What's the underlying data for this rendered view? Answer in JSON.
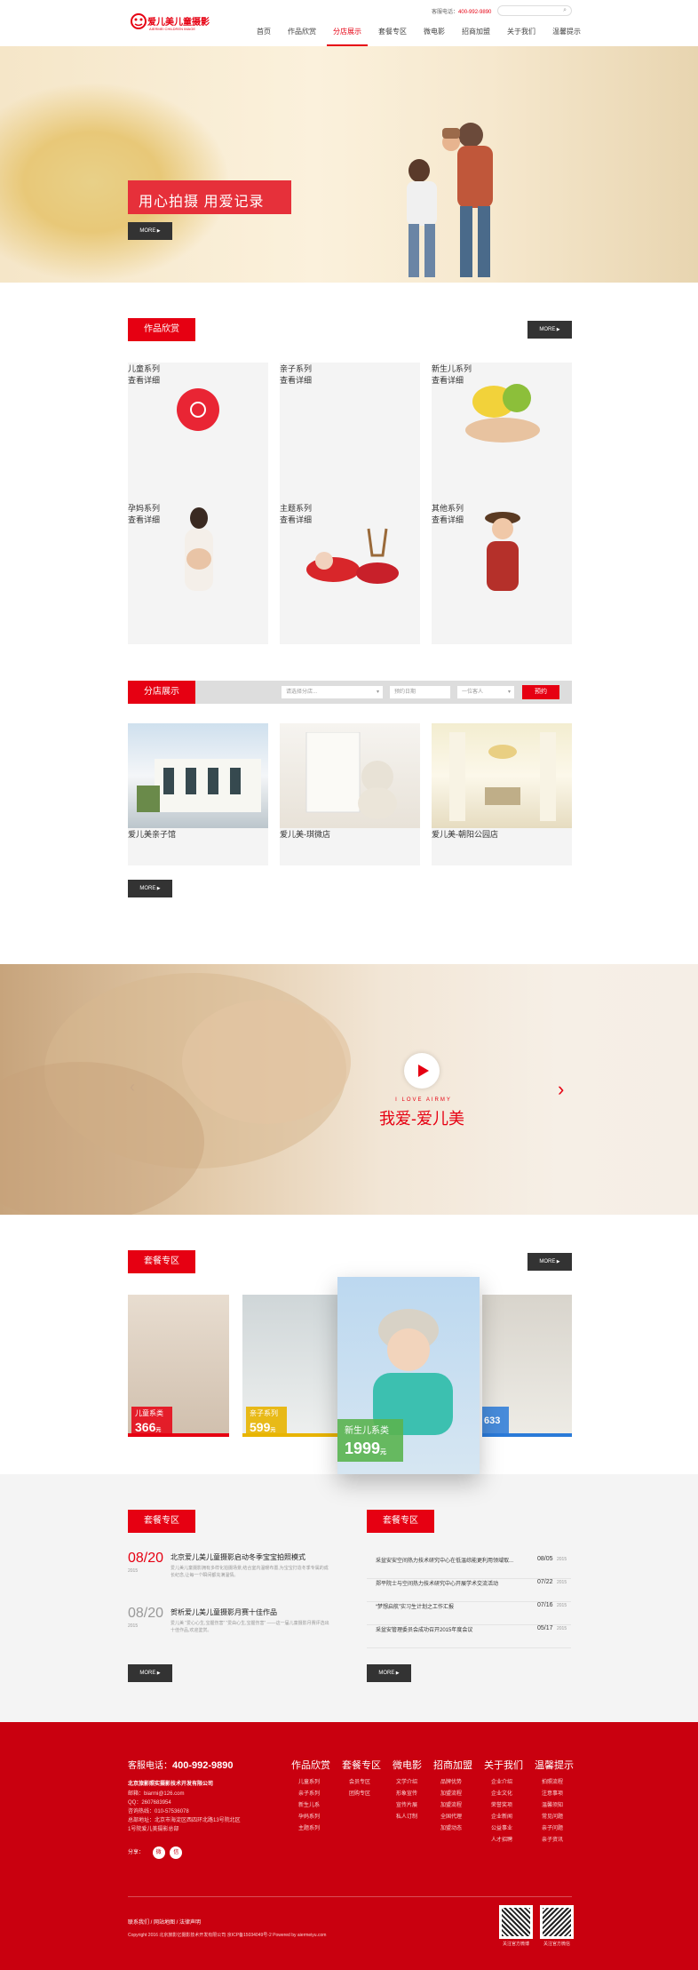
{
  "header": {
    "logo_text": "爱儿美儿童摄影",
    "logo_sub": "AIERMEI CHILDREN IMAGE",
    "hotline_label": "客服电话：",
    "hotline": "400-992-9890",
    "nav": [
      "首页",
      "作品欣赏",
      "分店展示",
      "套餐专区",
      "微电影",
      "招商加盟",
      "关于我们",
      "温馨提示"
    ],
    "active_nav": 2
  },
  "hero": {
    "slogan": "用心拍摄  用爱记录",
    "more": "MORE"
  },
  "works": {
    "title": "作品欣赏",
    "more": "MORE",
    "items": [
      {
        "title": "儿童系列",
        "sub": "查看详细"
      },
      {
        "title": "亲子系列",
        "sub": "查看详细"
      },
      {
        "title": "新生儿系列",
        "sub": "查看详细"
      },
      {
        "title": "孕妈系列",
        "sub": "查看详细"
      },
      {
        "title": "主题系列",
        "sub": "查看详细"
      },
      {
        "title": "其他系列",
        "sub": "查看详细"
      }
    ]
  },
  "stores": {
    "title": "分店展示",
    "select1": "请选择分店...",
    "select2": "预约日期",
    "select3": "一位客人",
    "book": "预约",
    "items": [
      "爱儿美亲子馆",
      "爱儿美-琪微店",
      "爱儿美-朝阳公园店"
    ],
    "more": "MORE"
  },
  "video": {
    "small": "I  LOVE  AIRMY",
    "big": "我爱-爱儿美"
  },
  "packages": {
    "title": "套餐专区",
    "more": "MORE",
    "items": [
      {
        "name": "儿童系类",
        "price": "366",
        "unit": "元"
      },
      {
        "name": "亲子系列",
        "price": "599",
        "unit": "元"
      },
      {
        "name": "新生儿系类",
        "price": "1999",
        "unit": "元"
      },
      {
        "name": "",
        "price": "633",
        "unit": "元"
      }
    ]
  },
  "news_left": {
    "title": "套餐专区",
    "more": "MORE",
    "items": [
      {
        "date": "08/20",
        "year": "2015",
        "headline": "北京爱儿美儿童摄影启动冬季宝宝拍照模式",
        "text": "爱儿美儿童摄影拥有多样化拍摄场景,结合室内温暖布置,为宝宝打造冬季专属的成长纪念,让每一个瞬间都充满温情。"
      },
      {
        "date": "08/20",
        "year": "2015",
        "headline": "贺析爱儿美儿童摄影月赛十佳作品",
        "text": "爱儿美 “爱心心生,宝握伤害” “爱由心生,宝握伤害” ——这一届儿童摄影月赛评选出十佳作品,欢迎鉴赏。"
      }
    ]
  },
  "news_right": {
    "title": "套餐专区",
    "more": "MORE",
    "items": [
      {
        "text": "采盆安安空间热力技术研究中心在低温综能更利用领域取...",
        "date": "08/05",
        "year": "2015"
      },
      {
        "text": "郑平院士与空间热力技术研究中心开展学术交流活动",
        "date": "07/22",
        "year": "2015"
      },
      {
        "text": "“梦想启航”实习生计划之工作汇报",
        "date": "07/16",
        "year": "2015"
      },
      {
        "text": "采盆安管理委员会成功召开2015年度会议",
        "date": "05/17",
        "year": "2015"
      }
    ]
  },
  "footer": {
    "phone_label": "客服电话：",
    "phone": "400-992-9890",
    "company": "北京旅影照实摄影技术开发有限公司",
    "lines": [
      "邮箱：biarmi@126.com",
      "QQ：2607683954",
      "咨询热线：010-57536078",
      "总部地址：北京市海淀区西四环北路13号院北区",
      "1号院爱儿美摄影总部"
    ],
    "share": "分享：",
    "columns": [
      {
        "title": "作品欣赏",
        "links": [
          "儿童系列",
          "亲子系列",
          "新生儿系",
          "孕妈系列",
          "主题系列"
        ]
      },
      {
        "title": "套餐专区",
        "links": [
          "会员专区",
          "团购专区"
        ]
      },
      {
        "title": "微电影",
        "links": [
          "文学介绍",
          "形象宣传",
          "宣传片展",
          "私人订制"
        ]
      },
      {
        "title": "招商加盟",
        "links": [
          "品牌优势",
          "加盟流程",
          "加盟流程",
          "全国代理",
          "加盟动态"
        ]
      },
      {
        "title": "关于我们",
        "links": [
          "企业介绍",
          "企业文化",
          "荣誉奖项",
          "企业新闻",
          "公益事业",
          "人才招聘"
        ]
      },
      {
        "title": "温馨提示",
        "links": [
          "拍照流程",
          "注意事项",
          "温馨须知",
          "常见问题",
          "亲子问题",
          "亲子资讯"
        ]
      }
    ],
    "bottom_links": "联系我们 / 网站地图 / 法律声明",
    "copyright": "Copyright 2016  北京旅影亿摄影技术开发有限公司    京ICP备15034049号-2    Powered by aiermeiyu.com",
    "qr_labels": [
      "关注官方微博",
      "关注官方微信"
    ]
  }
}
